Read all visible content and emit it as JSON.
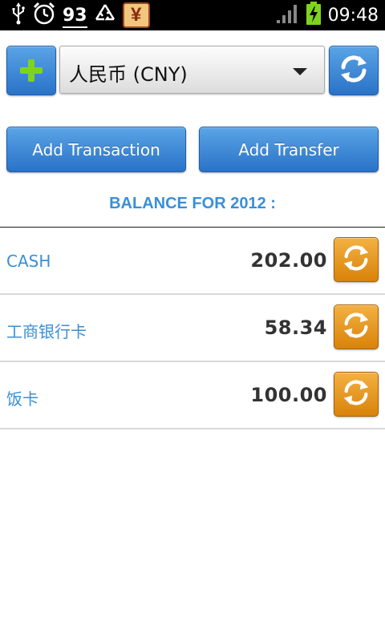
{
  "status_bar": {
    "icons": [
      "usb-icon",
      "alarm-icon",
      "recycle-icon",
      "yen-app-icon",
      "signal-icon",
      "battery-charging-icon"
    ],
    "notification_count": "93",
    "app_icon_glyph": "¥",
    "time": "09:48"
  },
  "toolbar": {
    "currency": "人民币 (CNY)"
  },
  "actions": {
    "add_transaction": "Add Transaction",
    "add_transfer": "Add Transfer"
  },
  "balance_title": "BALANCE FOR 2012 :",
  "accounts": [
    {
      "name": "CASH",
      "amount": "202.00"
    },
    {
      "name": "工商银行卡",
      "amount": "58.34"
    },
    {
      "name": "饭卡",
      "amount": "100.00"
    }
  ],
  "colors": {
    "accent_blue": "#3a8fd6",
    "button_blue": "#2a72c8",
    "button_orange": "#e8960f",
    "plus_green": "#7ed321"
  }
}
